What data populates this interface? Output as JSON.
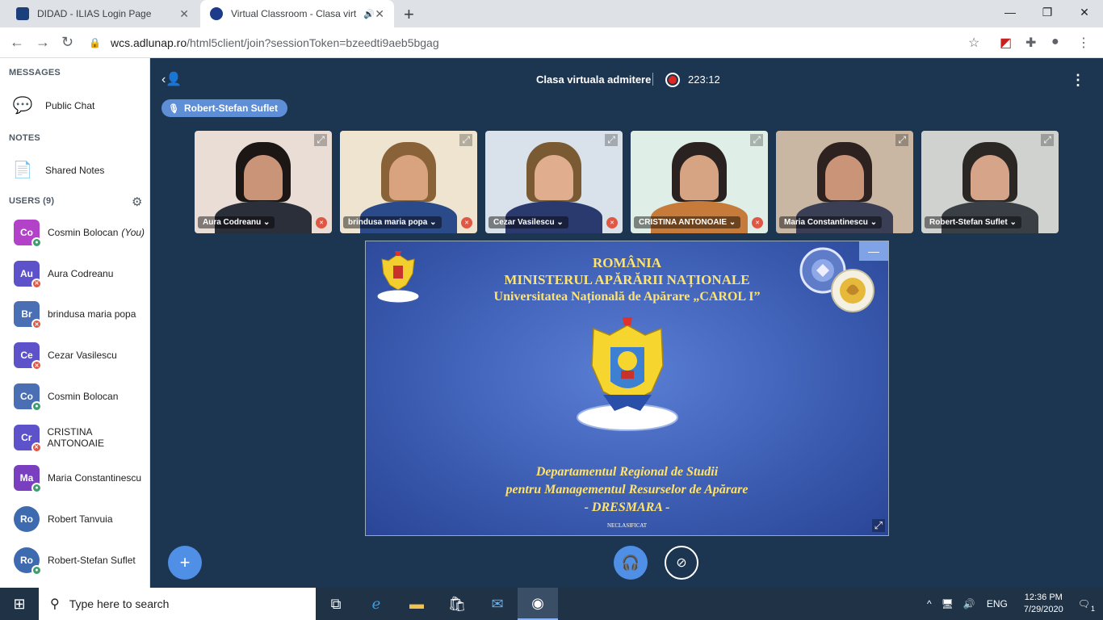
{
  "browser": {
    "tabs": [
      {
        "title": "DIDAD - ILIAS Login Page",
        "favicon": "ilias-icon",
        "active": false
      },
      {
        "title": "Virtual Classroom - Clasa virt",
        "favicon": "bigbluebutton-icon",
        "active": true
      }
    ],
    "new_tab": "+",
    "window_controls": [
      "—",
      "❐",
      "✕"
    ],
    "url_host": "wcs.adlunap.ro",
    "url_path": "/html5client/join?sessionToken=bzeedti9aeb5bgag"
  },
  "sidebar": {
    "messages_title": "MESSAGES",
    "public_chat": "Public Chat",
    "notes_title": "NOTES",
    "shared_notes": "Shared Notes",
    "users_title": "USERS (9)",
    "users": [
      {
        "initials": "Co",
        "name": "Cosmin Bolocan",
        "suffix": "(You)",
        "color": "#b242c7",
        "status": "mic",
        "shape": "square"
      },
      {
        "initials": "Au",
        "name": "Aura Codreanu",
        "suffix": "",
        "color": "#5d52c9",
        "status": "muted",
        "shape": "square"
      },
      {
        "initials": "Br",
        "name": "brindusa maria popa",
        "suffix": "",
        "color": "#4a6fb5",
        "status": "muted",
        "shape": "square"
      },
      {
        "initials": "Ce",
        "name": "Cezar Vasilescu",
        "suffix": "",
        "color": "#5d52c9",
        "status": "muted",
        "shape": "square"
      },
      {
        "initials": "Co",
        "name": "Cosmin Bolocan",
        "suffix": "",
        "color": "#4a6fb5",
        "status": "mic",
        "shape": "square"
      },
      {
        "initials": "Cr",
        "name": "CRISTINA ANTONOAIE",
        "suffix": "",
        "color": "#5d52c9",
        "status": "muted",
        "shape": "square"
      },
      {
        "initials": "Ma",
        "name": "Maria Constantinescu",
        "suffix": "",
        "color": "#7a3fbf",
        "status": "mic",
        "shape": "square"
      },
      {
        "initials": "Ro",
        "name": "Robert Tanvuia",
        "suffix": "",
        "color": "#3e6bb0",
        "status": "none",
        "shape": "round"
      },
      {
        "initials": "Ro",
        "name": "Robert-Stefan Suflet",
        "suffix": "",
        "color": "#3e6bb0",
        "status": "mic",
        "shape": "round"
      }
    ]
  },
  "meeting": {
    "title": "Clasa virtuala admitere",
    "recording_time": "223:12",
    "talking": "Robert-Stefan Suflet",
    "videos": [
      {
        "name": "Aura Codreanu",
        "muted": true,
        "bg": "#e9ddd6",
        "skin": "#c99478",
        "hair": "#1c1715",
        "shirt": "#2b2f3a"
      },
      {
        "name": "brindusa maria popa",
        "muted": true,
        "bg": "#efe4cf",
        "skin": "#d9a37f",
        "hair": "#8a6238",
        "shirt": "#2a4a8a"
      },
      {
        "name": "Cezar Vasilescu",
        "muted": true,
        "bg": "#d9e2ea",
        "skin": "#e0ad8e",
        "hair": "#7a5a32",
        "shirt": "#2b3a6e"
      },
      {
        "name": "CRISTINA ANTONOAIE",
        "muted": true,
        "bg": "#dfeee6",
        "skin": "#d7a483",
        "hair": "#2a2220",
        "shirt": "#c77b3a"
      },
      {
        "name": "Maria Constantinescu",
        "muted": false,
        "bg": "#c9b7a3",
        "skin": "#c99478",
        "hair": "#2d2220",
        "shirt": "#3a3f55"
      },
      {
        "name": "Robert-Stefan Suflet",
        "muted": false,
        "bg": "#cfd2cf",
        "skin": "#d6a589",
        "hair": "#2b2725",
        "shirt": "#3a3f46"
      }
    ]
  },
  "slide": {
    "line1": "ROMÂNIA",
    "line2": "MINISTERUL APĂRĂRII NAȚIONALE",
    "line3": "Universitatea Națională de Apărare „CAROL I”",
    "dept1": "Departamentul Regional de Studii",
    "dept2": "pentru Managementul Resurselor de Apărare",
    "dept3": "- DRESMARA -",
    "classification": "NECLASIFICAT",
    "minimize": "—"
  },
  "taskbar": {
    "search_placeholder": "Type here to search",
    "language": "ENG",
    "time": "12:36 PM",
    "date": "7/29/2020",
    "notifications": "1"
  }
}
